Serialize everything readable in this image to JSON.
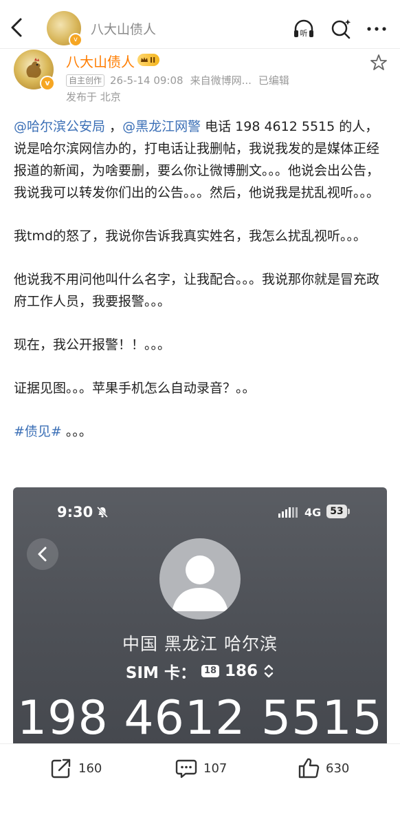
{
  "header": {
    "title": "八大山债人",
    "icons": [
      "back-icon",
      "listen-icon",
      "search-icon",
      "more-icon"
    ],
    "listen_label": "听"
  },
  "author": {
    "name": "八大山债人",
    "level": "II",
    "tag": "自主创作",
    "timestamp": "26-5-14 09:08",
    "source": "来自微博网...",
    "edited": "已编辑",
    "location": "发布于 北京",
    "verified_badge": "v",
    "accent": "#ff7d00"
  },
  "post": {
    "p1_mention1": "@哈尔滨公安局",
    "p1_sep": " ，",
    "p1_mention2": "@黑龙江网警",
    "p1_text": " 电话 198 4612 5515 的人，说是哈尔滨网信办的，打电话让我删帖，我说我发的是媒体正经报道的新闻，为啥要删，要么你让微博删文。。。他说会出公告，我说我可以转发你们出的公告。。。然后，他说我是扰乱视听。。。",
    "p2": "我tmd的怒了，我说你告诉我真实姓名，我怎么扰乱视听。。。",
    "p3": "他说我不用问他叫什么名字，让我配合。。。我说那你就是冒充政府工作人员，我要报警。。。",
    "p4": "现在，我公开报警！！。。。",
    "p5": "证据见图。。。苹果手机怎么自动录音？。。",
    "p6_hashtag": "#债见#",
    "p6_text": " 。。。",
    "link_color": "#3b6fb6"
  },
  "screenshot": {
    "time": "9:30",
    "network": "4G",
    "battery": "53",
    "region": "中国 黑龙江 哈尔滨",
    "sim_label": "SIM 卡：",
    "sim_chip": "18",
    "sim_number": "186",
    "phone_number": "198 4612 5515"
  },
  "actions": {
    "share_count": "160",
    "comment_count": "107",
    "like_count": "630"
  }
}
